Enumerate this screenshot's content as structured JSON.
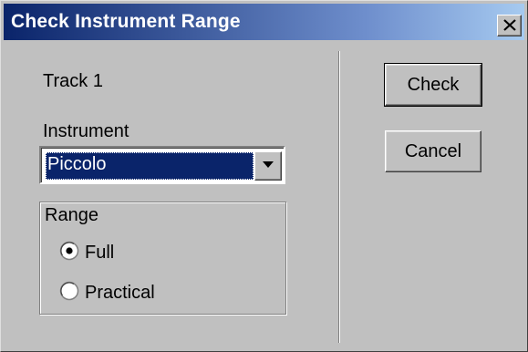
{
  "window": {
    "title": "Check Instrument Range"
  },
  "track": {
    "label": "Track 1"
  },
  "instrument": {
    "label": "Instrument",
    "selected": "Piccolo"
  },
  "range": {
    "label": "Range",
    "options": [
      {
        "label": "Full",
        "checked": true
      },
      {
        "label": "Practical",
        "checked": false
      }
    ]
  },
  "buttons": {
    "check": "Check",
    "cancel": "Cancel"
  },
  "icons": {
    "close": "close-icon",
    "dropdown": "chevron-down-icon"
  },
  "colors": {
    "title_bar_start": "#0a246a",
    "title_bar_end": "#a6caf0",
    "dialog_bg": "#c0c0c0",
    "selection_bg": "#0a246a"
  }
}
